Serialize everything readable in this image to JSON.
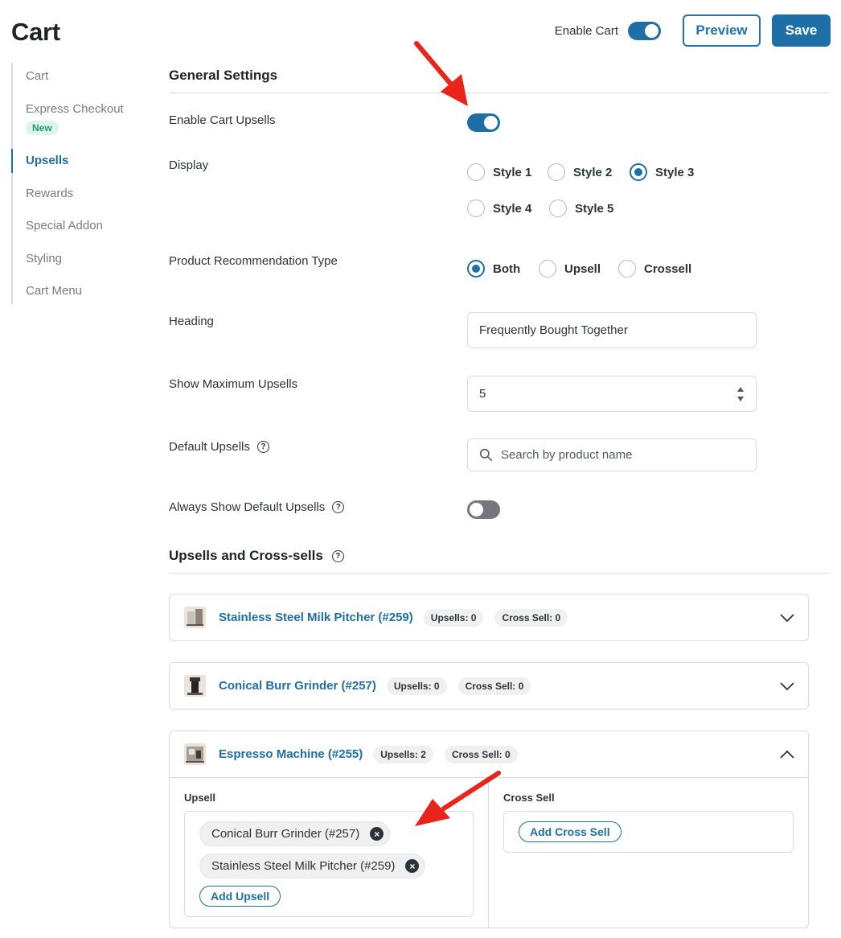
{
  "header": {
    "title": "Cart",
    "enable_cart_label": "Enable Cart",
    "enable_cart_on": true,
    "preview_label": "Preview",
    "save_label": "Save"
  },
  "sidebar": {
    "items": [
      {
        "label": "Cart"
      },
      {
        "label": "Express Checkout",
        "badge": "New"
      },
      {
        "label": "Upsells",
        "active": true
      },
      {
        "label": "Rewards"
      },
      {
        "label": "Special Addon"
      },
      {
        "label": "Styling"
      },
      {
        "label": "Cart Menu"
      }
    ]
  },
  "general": {
    "title": "General Settings",
    "enable_upsells_label": "Enable Cart Upsells",
    "enable_upsells_on": true,
    "display_label": "Display",
    "display_options": [
      "Style 1",
      "Style 2",
      "Style 3",
      "Style 4",
      "Style 5"
    ],
    "display_selected": "Style 3",
    "rec_type_label": "Product Recommendation Type",
    "rec_type_options": [
      "Both",
      "Upsell",
      "Crossell"
    ],
    "rec_type_selected": "Both",
    "heading_label": "Heading",
    "heading_value": "Frequently Bought Together",
    "max_upsells_label": "Show Maximum Upsells",
    "max_upsells_value": "5",
    "default_upsells_label": "Default Upsells",
    "default_upsells_placeholder": "Search by product name",
    "always_show_label": "Always Show Default Upsells",
    "always_show_on": false
  },
  "upsells_section": {
    "title": "Upsells and Cross-sells",
    "products": [
      {
        "name": "Stainless Steel Milk Pitcher (#259)",
        "upsells": "Upsells: 0",
        "cross_sell": "Cross Sell: 0",
        "expanded": false
      },
      {
        "name": "Conical Burr Grinder (#257)",
        "upsells": "Upsells: 0",
        "cross_sell": "Cross Sell: 0",
        "expanded": false
      },
      {
        "name": "Espresso Machine (#255)",
        "upsells": "Upsells: 2",
        "cross_sell": "Cross Sell: 0",
        "expanded": true
      }
    ],
    "expanded": {
      "upsell_label": "Upsell",
      "upsell_tags": [
        "Conical Burr Grinder (#257)",
        "Stainless Steel Milk Pitcher (#259)"
      ],
      "add_upsell_label": "Add Upsell",
      "cross_sell_label": "Cross Sell",
      "add_cross_sell_label": "Add Cross Sell"
    }
  },
  "colors": {
    "accent": "#1e6fa6",
    "annotation_arrow": "#e8241b"
  }
}
